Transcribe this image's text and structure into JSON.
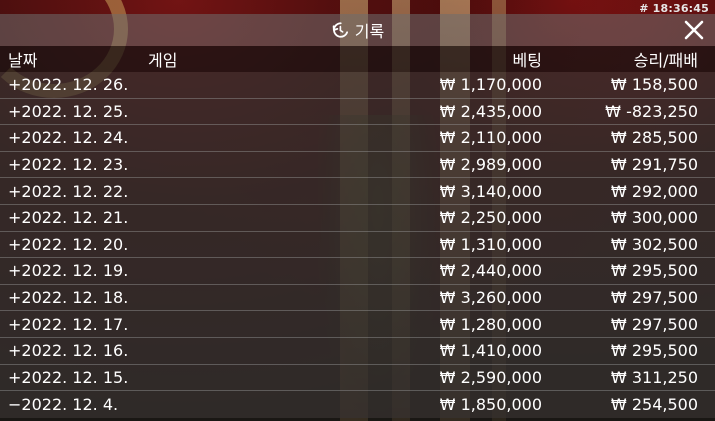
{
  "timestamp": "# 18:36:45",
  "header": {
    "title": "기록",
    "history_icon": "history-icon",
    "close_icon": "close-icon"
  },
  "columns": {
    "date": "날짜",
    "game": "게임",
    "bet": "베팅",
    "win_loss": "승리/패배"
  },
  "rows": [
    {
      "date": "+2022. 12. 26.",
      "game": "",
      "bet": "₩ 1,170,000",
      "win_loss": "₩ 158,500"
    },
    {
      "date": "+2022. 12. 25.",
      "game": "",
      "bet": "₩ 2,435,000",
      "win_loss": "₩ -823,250"
    },
    {
      "date": "+2022. 12. 24.",
      "game": "",
      "bet": "₩ 2,110,000",
      "win_loss": "₩ 285,500"
    },
    {
      "date": "+2022. 12. 23.",
      "game": "",
      "bet": "₩ 2,989,000",
      "win_loss": "₩ 291,750"
    },
    {
      "date": "+2022. 12. 22.",
      "game": "",
      "bet": "₩ 3,140,000",
      "win_loss": "₩ 292,000"
    },
    {
      "date": "+2022. 12. 21.",
      "game": "",
      "bet": "₩ 2,250,000",
      "win_loss": "₩ 300,000"
    },
    {
      "date": "+2022. 12. 20.",
      "game": "",
      "bet": "₩ 1,310,000",
      "win_loss": "₩ 302,500"
    },
    {
      "date": "+2022. 12. 19.",
      "game": "",
      "bet": "₩ 2,440,000",
      "win_loss": "₩ 295,500"
    },
    {
      "date": "+2022. 12. 18.",
      "game": "",
      "bet": "₩ 3,260,000",
      "win_loss": "₩ 297,500"
    },
    {
      "date": "+2022. 12. 17.",
      "game": "",
      "bet": "₩ 1,280,000",
      "win_loss": "₩ 297,500"
    },
    {
      "date": "+2022. 12. 16.",
      "game": "",
      "bet": "₩ 1,410,000",
      "win_loss": "₩ 295,500"
    },
    {
      "date": "+2022. 12. 15.",
      "game": "",
      "bet": "₩ 2,590,000",
      "win_loss": "₩ 311,250"
    },
    {
      "date": "−2022. 12. 4.",
      "game": "",
      "bet": "₩ 1,850,000",
      "win_loss": "₩ 254,500"
    }
  ]
}
